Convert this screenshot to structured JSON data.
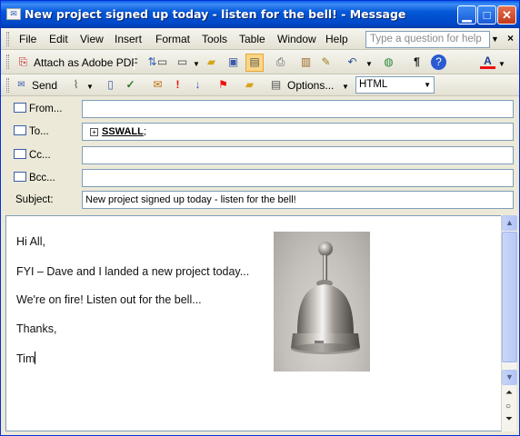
{
  "window": {
    "title": "New project signed up today - listen for the bell! - Message"
  },
  "menu": {
    "items": [
      {
        "label": "File"
      },
      {
        "label": "Edit"
      },
      {
        "label": "View"
      },
      {
        "label": "Insert"
      },
      {
        "label": "Format"
      },
      {
        "label": "Tools"
      },
      {
        "label": "Table"
      },
      {
        "label": "Window"
      },
      {
        "label": "Help"
      }
    ],
    "question_placeholder": "Type a question for help"
  },
  "toolbar1": {
    "attach_pdf_label": "Attach as Adobe PDF"
  },
  "toolbar2": {
    "send_label": "Send",
    "options_label": "Options...",
    "format_value": "HTML"
  },
  "header": {
    "from_label": "From...",
    "to_label": "To...",
    "cc_label": "Cc...",
    "bcc_label": "Bcc...",
    "subject_label": "Subject:",
    "from_value": "",
    "to_recipient": "SSWALL",
    "to_suffix": ";",
    "cc_value": "",
    "bcc_value": "",
    "subject_value": "New project signed up today - listen for the bell!"
  },
  "body": {
    "lines": [
      "Hi All,",
      "FYI – Dave and I landed a new project today...",
      "We're on fire! Listen out for the bell...",
      "Thanks,",
      "Tim"
    ]
  },
  "icons": {
    "send": "send-icon",
    "attach": "paperclip-icon",
    "address_book": "address-book-icon",
    "spell_check": "spell-check-icon",
    "importance_high": "importance-high-icon",
    "importance_low": "importance-low-icon",
    "flag": "flag-icon",
    "bell_image": "bell-image"
  },
  "colors": {
    "title_bar": "#0a5fe9",
    "close_button": "#c2381b",
    "menu_bar": "#ece9d8",
    "field_border": "#7f9db9"
  }
}
